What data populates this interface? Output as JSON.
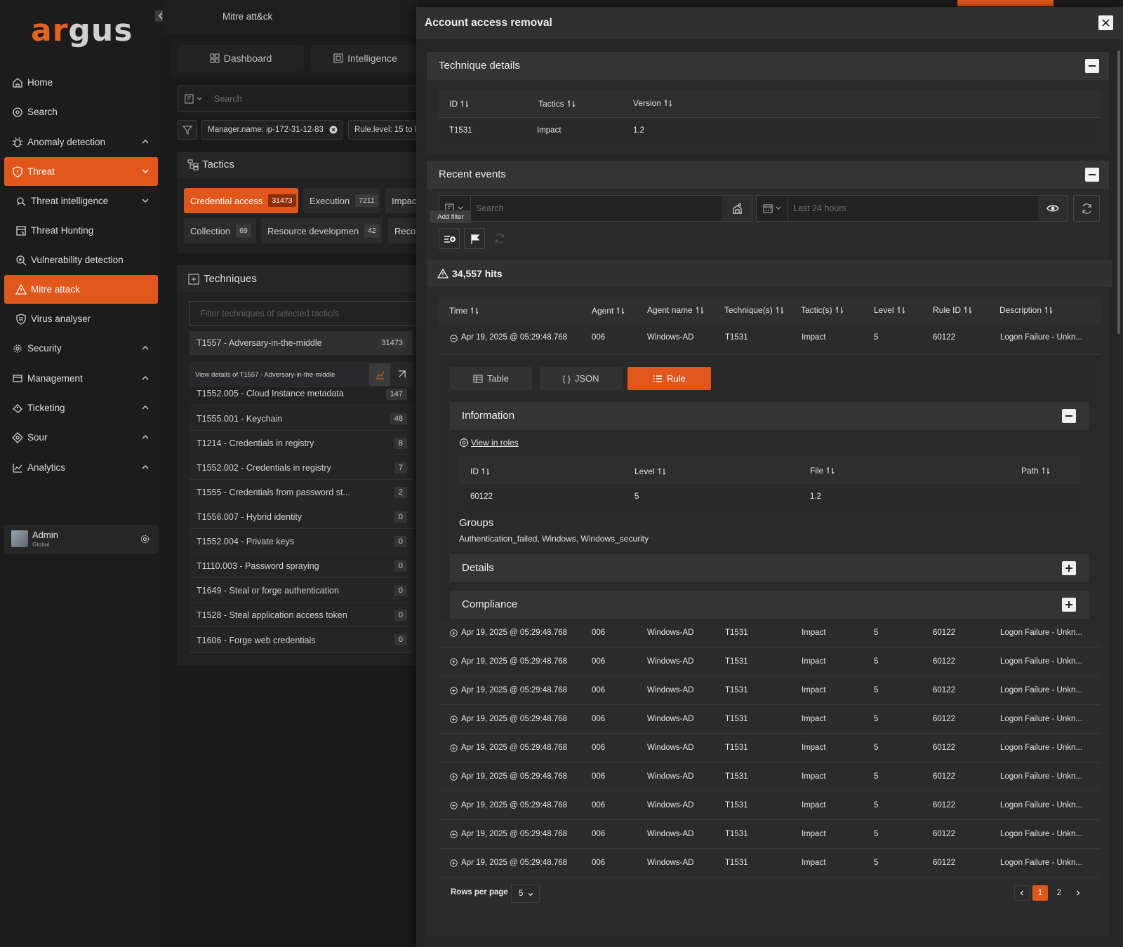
{
  "brand": {
    "logo_text_a": "ar",
    "logo_text_b": "gus",
    "accent": "#e0561b"
  },
  "sidebar": {
    "items": [
      {
        "label": "Home",
        "icon": "home-icon"
      },
      {
        "label": "Search",
        "icon": "search-icon"
      },
      {
        "label": "Anomaly detection",
        "icon": "bug-icon"
      },
      {
        "label": "Threat",
        "icon": "shield-icon"
      },
      {
        "label": "Threat intelligence",
        "icon": "intel-icon"
      },
      {
        "label": "Threat Hunting",
        "icon": "hunting-icon"
      },
      {
        "label": "Vulnerability detection",
        "icon": "vulnerability-icon"
      },
      {
        "label": "Mitre attack",
        "icon": "mitre-icon"
      },
      {
        "label": "Virus analyser",
        "icon": "virus-icon"
      },
      {
        "label": "Security",
        "icon": "gear-cluster-icon"
      },
      {
        "label": "Management",
        "icon": "management-icon"
      },
      {
        "label": "Ticketing",
        "icon": "ticket-icon"
      },
      {
        "label": "Sour",
        "icon": "source-icon"
      },
      {
        "label": "Analytics",
        "icon": "analytics-icon"
      }
    ],
    "user": {
      "name": "Admin",
      "role": "Global"
    }
  },
  "main": {
    "title": "Mitre att&ck",
    "tabs": [
      {
        "label": "Dashboard"
      },
      {
        "label": "Intelligence"
      }
    ],
    "search_placeholder": "Search",
    "filters": [
      {
        "label": "Manager.name: ip-172-31-12-83"
      },
      {
        "label": "Rule.level: 15 to Ir"
      }
    ],
    "tactics_title": "Tactics",
    "tactics": [
      {
        "label": "Credential access",
        "count": "31473"
      },
      {
        "label": "Execution",
        "count": "7211"
      },
      {
        "label": "Impac",
        "count": ""
      },
      {
        "label": "Collection",
        "count": "69"
      },
      {
        "label": "Resource developmen",
        "count": "42"
      },
      {
        "label": "Reco",
        "count": ""
      }
    ],
    "techniques_title": "Techniques",
    "techniques_filter_placeholder": "Filter techniques of selected tactic/s",
    "hover_text": "View details of T1557 - Adversary-in-the-middle",
    "techniques": [
      {
        "label": "T1557 - Adversary-in-the-middle",
        "count": "31473"
      },
      {
        "label": "T1552.005 - Cloud Instance metadata",
        "count": "147"
      },
      {
        "label": "T1555.001 - Keychain",
        "count": "48"
      },
      {
        "label": "T1214 - Credentials in registry",
        "count": "8"
      },
      {
        "label": "T1552.002 - Credentials in registry",
        "count": "7"
      },
      {
        "label": "T1555 - Credentials from password st...",
        "count": "2"
      },
      {
        "label": "T1556.007 - Hybrid identity",
        "count": "0"
      },
      {
        "label": "T1552.004 - Private keys",
        "count": "0"
      },
      {
        "label": "T1110.003 - Password spraying",
        "count": "0"
      },
      {
        "label": "T1649 - Steal or forge authentication",
        "count": "0"
      },
      {
        "label": "T1528 - Steal application access token",
        "count": "0"
      },
      {
        "label": "T1606 - Forge web credentials",
        "count": "0"
      }
    ]
  },
  "modal": {
    "title": "Account access removal",
    "technique_details": {
      "title": "Technique details",
      "columns": [
        "ID",
        "Tactics",
        "Version"
      ],
      "row": [
        "T1531",
        "Impact",
        "1.2"
      ]
    },
    "recent_events": {
      "title": "Recent events",
      "search_placeholder": "Search",
      "date_placeholder": "Last 24 hours",
      "tooltip": "Add filter",
      "hits": "34,557 hits",
      "columns": [
        "Time",
        "Agent",
        "Agent name",
        "Technique(s)",
        "Tactic(s)",
        "Level",
        "Rule ID",
        "Description"
      ],
      "expanded_row": [
        "Apr 19, 2025 @ 05:29:48.768",
        "006",
        "Windows-AD",
        "T1531",
        "Impact",
        "5",
        "60122",
        "Logon Failure - Unkn..."
      ],
      "view_tabs": [
        {
          "label": "Table"
        },
        {
          "label": "JSON"
        },
        {
          "label": "Rule"
        }
      ],
      "information": {
        "title": "Information",
        "link": "View in roles",
        "columns": [
          "ID",
          "Level",
          "File",
          "Path"
        ],
        "row": [
          "60122",
          "5",
          "1.2",
          ""
        ],
        "groups_title": "Groups",
        "groups": "Authentication_failed, Windows, Windows_security"
      },
      "details_title": "Details",
      "compliance_title": "Compliance",
      "rows": [
        [
          "Apr 19, 2025 @ 05:29:48.768",
          "006",
          "Windows-AD",
          "T1531",
          "Impact",
          "5",
          "60122",
          "Logon Failure - Unkn..."
        ],
        [
          "Apr 19, 2025 @ 05:29:48.768",
          "006",
          "Windows-AD",
          "T1531",
          "Impact",
          "5",
          "60122",
          "Logon Failure - Unkn..."
        ],
        [
          "Apr 19, 2025 @ 05:29:48.768",
          "006",
          "Windows-AD",
          "T1531",
          "Impact",
          "5",
          "60122",
          "Logon Failure - Unkn..."
        ],
        [
          "Apr 19, 2025 @ 05:29:48.768",
          "006",
          "Windows-AD",
          "T1531",
          "Impact",
          "5",
          "60122",
          "Logon Failure - Unkn..."
        ],
        [
          "Apr 19, 2025 @ 05:29:48.768",
          "006",
          "Windows-AD",
          "T1531",
          "Impact",
          "5",
          "60122",
          "Logon Failure - Unkn..."
        ],
        [
          "Apr 19, 2025 @ 05:29:48.768",
          "006",
          "Windows-AD",
          "T1531",
          "Impact",
          "5",
          "60122",
          "Logon Failure - Unkn..."
        ],
        [
          "Apr 19, 2025 @ 05:29:48.768",
          "006",
          "Windows-AD",
          "T1531",
          "Impact",
          "5",
          "60122",
          "Logon Failure - Unkn..."
        ],
        [
          "Apr 19, 2025 @ 05:29:48.768",
          "006",
          "Windows-AD",
          "T1531",
          "Impact",
          "5",
          "60122",
          "Logon Failure - Unkn..."
        ],
        [
          "Apr 19, 2025 @ 05:29:48.768",
          "006",
          "Windows-AD",
          "T1531",
          "Impact",
          "5",
          "60122",
          "Logon Failure - Unkn..."
        ]
      ],
      "rows_per_page_label": "Rows per page",
      "rows_per_page": "5",
      "pages": [
        "1",
        "2"
      ],
      "current_page": "1"
    }
  }
}
